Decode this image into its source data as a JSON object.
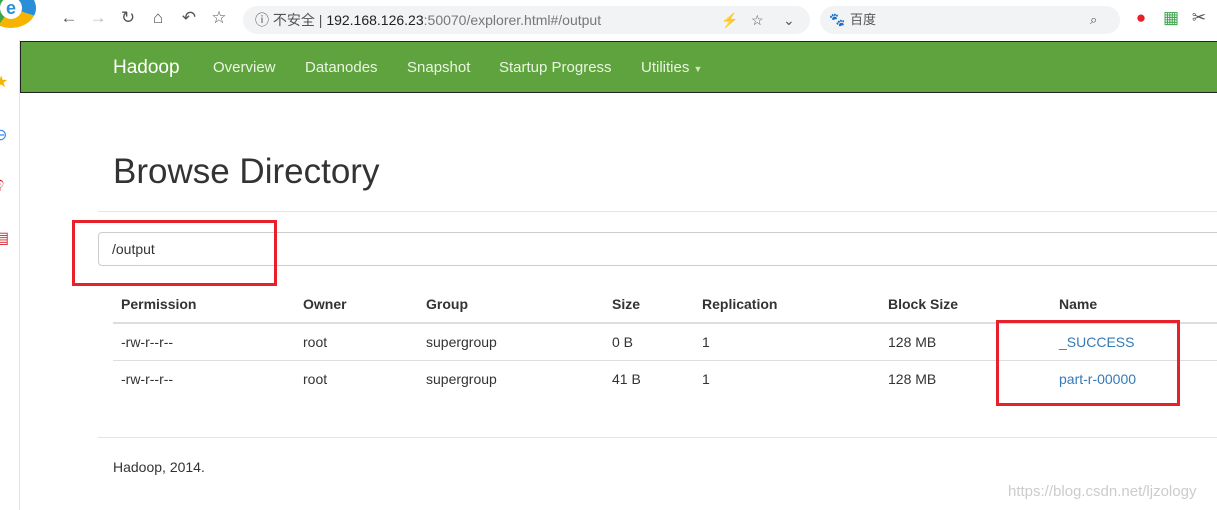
{
  "browser": {
    "security_label": "不安全",
    "url_host": "192.168.126.23",
    "url_rest": ":50070/explorer.html#/output",
    "search_engine": "百度"
  },
  "navbar": {
    "brand": "Hadoop",
    "items": [
      "Overview",
      "Datanodes",
      "Snapshot",
      "Startup Progress",
      "Utilities"
    ]
  },
  "page": {
    "title": "Browse Directory",
    "path": "/output"
  },
  "table": {
    "headers": [
      "Permission",
      "Owner",
      "Group",
      "Size",
      "Replication",
      "Block Size",
      "Name"
    ],
    "rows": [
      [
        "-rw-r--r--",
        "root",
        "supergroup",
        "0 B",
        "1",
        "128 MB",
        "_SUCCESS"
      ],
      [
        "-rw-r--r--",
        "root",
        "supergroup",
        "41 B",
        "1",
        "128 MB",
        "part-r-00000"
      ]
    ]
  },
  "footer": "Hadoop, 2014.",
  "watermark": "https://blog.csdn.net/ljzology",
  "colors": {
    "navbar": "#5fa33e",
    "link": "#337ab7",
    "highlight": "#e8202a"
  }
}
